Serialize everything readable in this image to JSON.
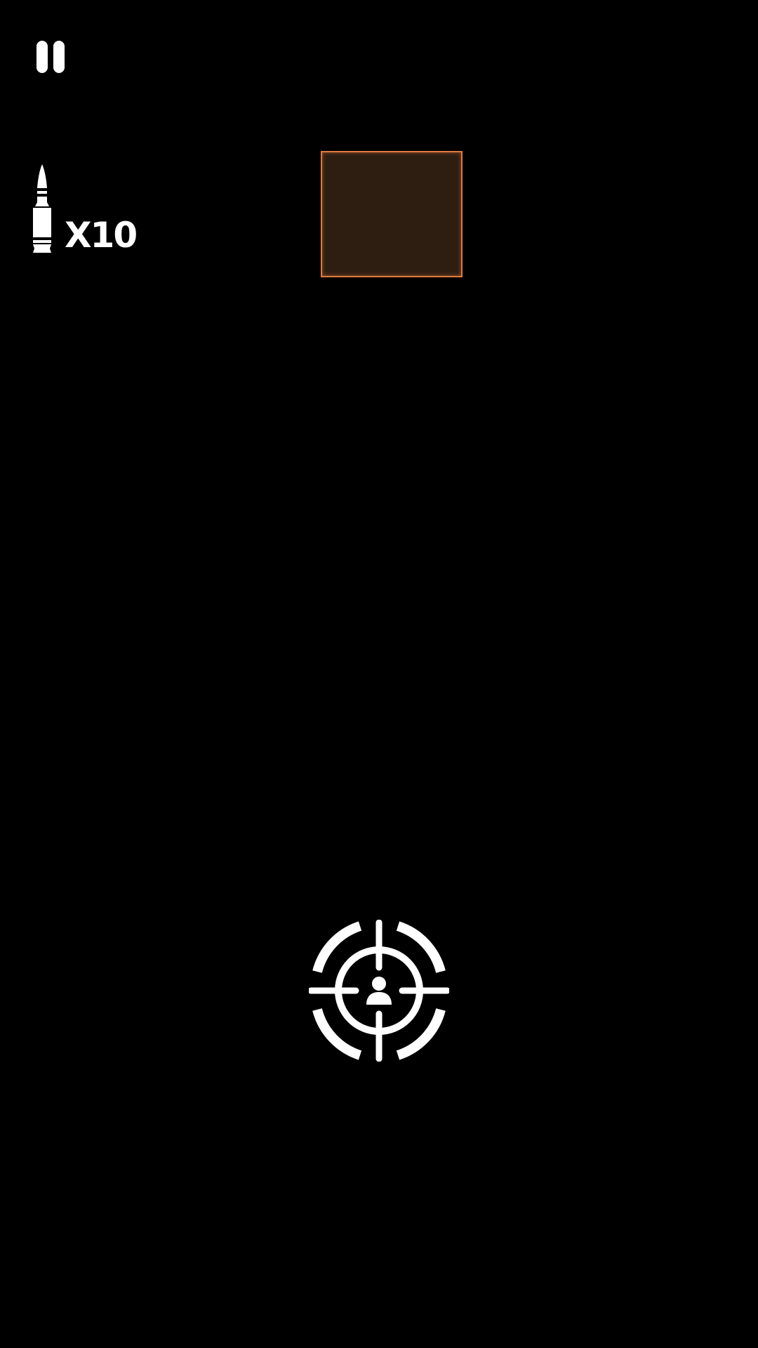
{
  "hud": {
    "pause_icon": "pause-icon",
    "ammo": {
      "icon": "bullet-icon",
      "count_label": "X10"
    },
    "target_panel": {
      "fill_color": "#2e1e12",
      "border_color": "#e0793e"
    },
    "fire_button": {
      "icon": "crosshair-icon"
    }
  }
}
